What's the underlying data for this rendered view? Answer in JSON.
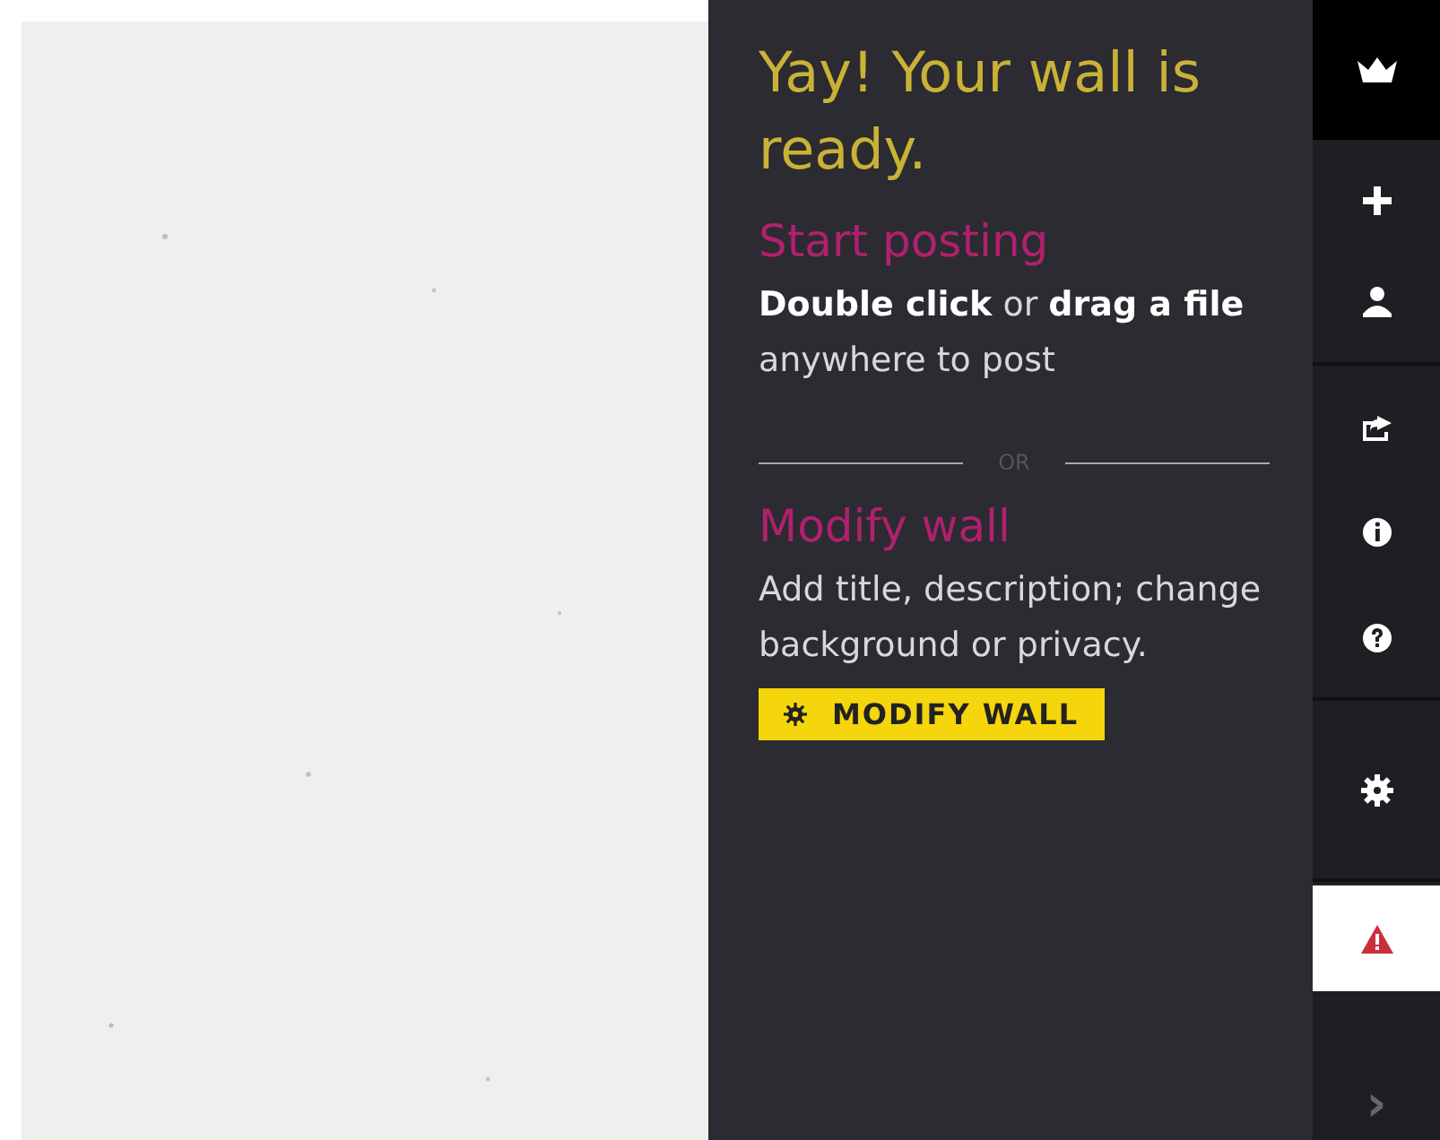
{
  "panel": {
    "title": "Yay! Your wall is ready.",
    "sections": [
      {
        "heading": "Start posting",
        "text": "**Double click** or **drag a file** anywhere to post"
      },
      {
        "kind": "divider",
        "label": "OR"
      },
      {
        "heading": "Modify wall",
        "text": "Add title, description; change background or privacy."
      }
    ],
    "button": "MODIFY WALL"
  },
  "rail": {
    "groups": [
      [
        {
          "kind": "plus",
          "selected": false
        },
        {
          "kind": "person",
          "selected": false
        }
      ],
      [
        {
          "kind": "share",
          "selected": false
        },
        {
          "kind": "info",
          "selected": false
        },
        {
          "kind": "help",
          "selected": false
        }
      ],
      [
        {
          "kind": "gear",
          "selected": false
        }
      ],
      [
        {
          "kind": "alert",
          "selected": true
        }
      ]
    ],
    "collapse": "›"
  }
}
